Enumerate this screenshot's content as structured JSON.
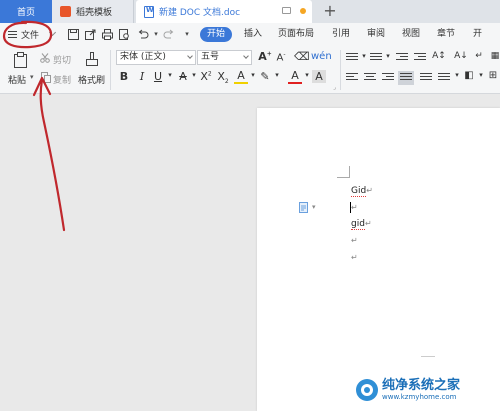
{
  "tabs": {
    "home": "首页",
    "template": "稻壳模板",
    "document": "新建 DOC 文档.doc",
    "add": "+"
  },
  "menu": {
    "file": "文件",
    "items": [
      "开始",
      "插入",
      "页面布局",
      "引用",
      "审阅",
      "视图",
      "章节",
      "开"
    ]
  },
  "ribbon": {
    "paste": "粘贴",
    "cut": "剪切",
    "copy": "复制",
    "format_painter": "格式刷",
    "font_name": "宋体 (正文)",
    "font_size": "五号"
  },
  "document": {
    "lines": [
      "Gid",
      "",
      "gid",
      ""
    ]
  },
  "watermark": {
    "title": "纯净系统之家",
    "url": "www.kzmyhome.com"
  },
  "colors": {
    "accent": "#3b78d8",
    "annotation": "#c0282d"
  }
}
